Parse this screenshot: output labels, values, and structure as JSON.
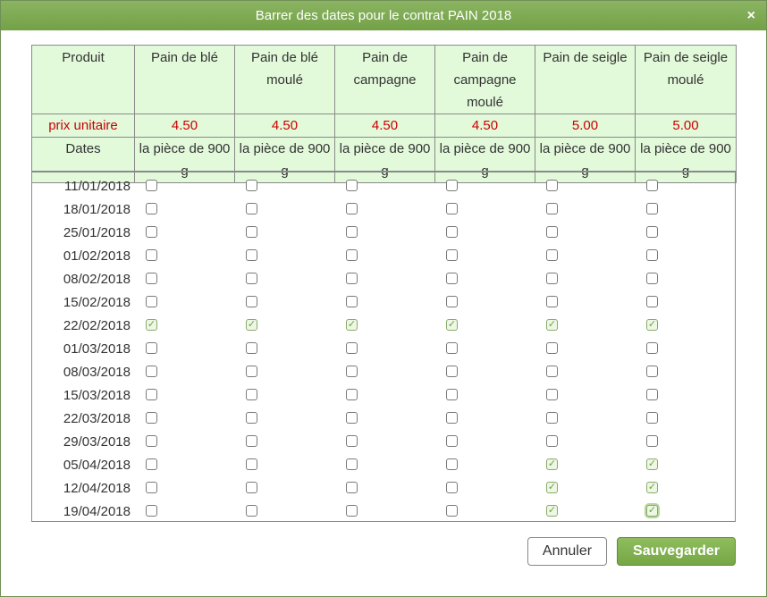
{
  "dialog": {
    "title": "Barrer des dates pour le contrat PAIN 2018",
    "close_symbol": "×"
  },
  "header": {
    "product_label": "Produit",
    "price_label": "prix unitaire",
    "dates_label": "Dates",
    "products": [
      {
        "name": "Pain de blé",
        "price": "4.50",
        "unit": "la pièce de 900 g"
      },
      {
        "name": "Pain de blé moulé",
        "price": "4.50",
        "unit": "la pièce de 900 g"
      },
      {
        "name": "Pain de campagne",
        "price": "4.50",
        "unit": "la pièce de 900 g"
      },
      {
        "name": "Pain de campagne moulé",
        "price": "4.50",
        "unit": "la pièce de 900 g"
      },
      {
        "name": "Pain de seigle",
        "price": "5.00",
        "unit": "la pièce de 900 g"
      },
      {
        "name": "Pain de seigle moulé",
        "price": "5.00",
        "unit": "la pièce de 900 g"
      }
    ]
  },
  "rows": [
    {
      "date": "11/01/2018",
      "checks": [
        false,
        false,
        false,
        false,
        false,
        false
      ]
    },
    {
      "date": "18/01/2018",
      "checks": [
        false,
        false,
        false,
        false,
        false,
        false
      ]
    },
    {
      "date": "25/01/2018",
      "checks": [
        false,
        false,
        false,
        false,
        false,
        false
      ]
    },
    {
      "date": "01/02/2018",
      "checks": [
        false,
        false,
        false,
        false,
        false,
        false
      ]
    },
    {
      "date": "08/02/2018",
      "checks": [
        false,
        false,
        false,
        false,
        false,
        false
      ]
    },
    {
      "date": "15/02/2018",
      "checks": [
        false,
        false,
        false,
        false,
        false,
        false
      ]
    },
    {
      "date": "22/02/2018",
      "checks": [
        true,
        true,
        true,
        true,
        true,
        true
      ]
    },
    {
      "date": "01/03/2018",
      "checks": [
        false,
        false,
        false,
        false,
        false,
        false
      ]
    },
    {
      "date": "08/03/2018",
      "checks": [
        false,
        false,
        false,
        false,
        false,
        false
      ]
    },
    {
      "date": "15/03/2018",
      "checks": [
        false,
        false,
        false,
        false,
        false,
        false
      ]
    },
    {
      "date": "22/03/2018",
      "checks": [
        false,
        false,
        false,
        false,
        false,
        false
      ]
    },
    {
      "date": "29/03/2018",
      "checks": [
        false,
        false,
        false,
        false,
        false,
        false
      ]
    },
    {
      "date": "05/04/2018",
      "checks": [
        false,
        false,
        false,
        false,
        true,
        true
      ]
    },
    {
      "date": "12/04/2018",
      "checks": [
        false,
        false,
        false,
        false,
        true,
        true
      ]
    },
    {
      "date": "19/04/2018",
      "checks": [
        false,
        false,
        false,
        false,
        true,
        true
      ]
    }
  ],
  "check_symbol": "✓",
  "buttons": {
    "cancel": "Annuler",
    "save": "Sauvegarder"
  },
  "colors": {
    "title_bar": "#7aa94c",
    "header_bg": "#e2f9da",
    "price_text": "#cc0000",
    "save_button": "#7eae4e"
  }
}
